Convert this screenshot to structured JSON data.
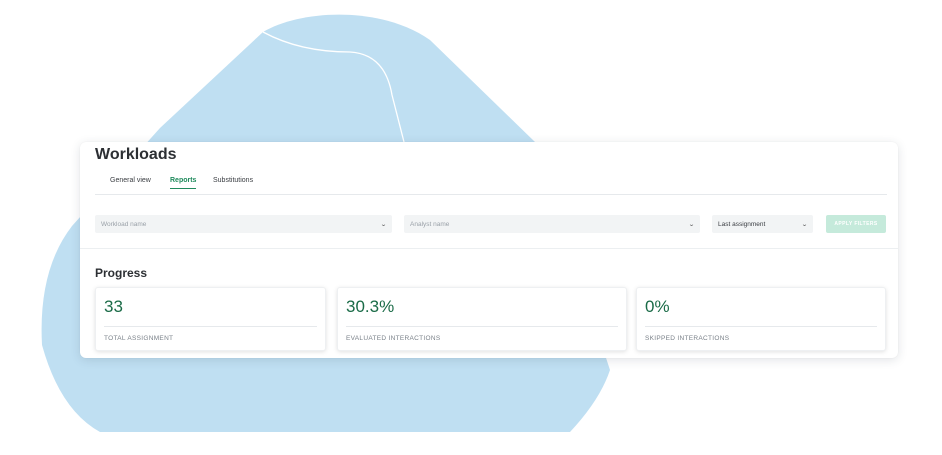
{
  "page": {
    "title": "Workloads"
  },
  "tabs": [
    {
      "label": "General view",
      "active": false
    },
    {
      "label": "Reports",
      "active": true
    },
    {
      "label": "Substitutions",
      "active": false
    }
  ],
  "filters": {
    "workload": {
      "placeholder": "Workload name"
    },
    "analyst": {
      "placeholder": "Analyst name"
    },
    "sort": {
      "value": "Last assignment"
    },
    "apply_label": "APPLY FILTERS"
  },
  "progress": {
    "title": "Progress",
    "metrics": [
      {
        "value": "33",
        "label": "TOTAL ASSIGNMENT"
      },
      {
        "value": "30.3%",
        "label": "EVALUATED INTERACTIONS"
      },
      {
        "value": "0%",
        "label": "SKIPPED INTERACTIONS"
      }
    ]
  },
  "icons": {
    "dropdown": "chevron-down-icon"
  },
  "colors": {
    "accent": "#1f8a5c",
    "metric_value": "#1a6b47",
    "background_shape": "#bfdff2",
    "apply_button": "#c5eadb"
  }
}
